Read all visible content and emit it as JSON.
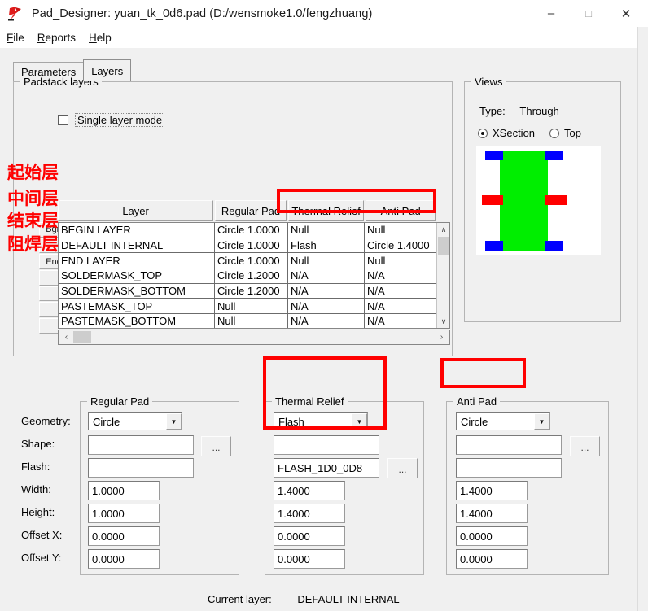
{
  "window": {
    "title": "Pad_Designer: yuan_tk_0d6.pad (D:/wensmoke1.0/fengzhuang)",
    "icon": "pad-designer-icon",
    "minimize": "–",
    "maximize": "□",
    "close": "✕"
  },
  "menubar": {
    "items": [
      {
        "label": "File",
        "accel": "F"
      },
      {
        "label": "Reports",
        "accel": "R"
      },
      {
        "label": "Help",
        "accel": "H"
      }
    ]
  },
  "tabs": [
    {
      "label": "Parameters",
      "active": false
    },
    {
      "label": "Layers",
      "active": true
    }
  ],
  "padstack": {
    "group_title": "Padstack layers",
    "single_layer_mode": {
      "label": "Single layer mode",
      "checked": false
    },
    "columns": [
      "Layer",
      "Regular Pad",
      "Thermal Relief",
      "Anti Pad"
    ],
    "stub_buttons": [
      "Bgn",
      "",
      "End",
      "",
      "",
      "",
      ""
    ],
    "rows": [
      {
        "layer": "BEGIN LAYER",
        "regular": "Circle 1.0000",
        "thermal": "Null",
        "anti": "Null"
      },
      {
        "layer": "DEFAULT INTERNAL",
        "regular": "Circle 1.0000",
        "thermal": "Flash",
        "anti": "Circle 1.4000"
      },
      {
        "layer": "END LAYER",
        "regular": "Circle 1.0000",
        "thermal": "Null",
        "anti": "Null"
      },
      {
        "layer": "SOLDERMASK_TOP",
        "regular": "Circle 1.2000",
        "thermal": "N/A",
        "anti": "N/A"
      },
      {
        "layer": "SOLDERMASK_BOTTOM",
        "regular": "Circle 1.2000",
        "thermal": "N/A",
        "anti": "N/A"
      },
      {
        "layer": "PASTEMASK_TOP",
        "regular": "Null",
        "thermal": "N/A",
        "anti": "N/A"
      },
      {
        "layer": "PASTEMASK_BOTTOM",
        "regular": "Null",
        "thermal": "N/A",
        "anti": "N/A"
      }
    ],
    "scroll": {
      "up_arrow": "∧",
      "down_arrow": "∨",
      "left_arrow": "‹",
      "right_arrow": "›"
    }
  },
  "views": {
    "group_title": "Views",
    "type_label": "Type:",
    "type_value": "Through",
    "radios": [
      {
        "label": "XSection",
        "selected": true
      },
      {
        "label": "Top",
        "selected": false
      }
    ],
    "colors": {
      "pad": "#00ee00",
      "regular": "#0000ff",
      "thermal": "#ff0000",
      "background": "#ffffff"
    }
  },
  "fields": {
    "labels": [
      "Geometry:",
      "Shape:",
      "Flash:",
      "Width:",
      "Height:",
      "Offset X:",
      "Offset Y:"
    ],
    "ellipsis": "..."
  },
  "panels": {
    "regular_pad": {
      "title": "Regular Pad",
      "geometry": "Circle",
      "shape": "",
      "flash": "",
      "width": "1.0000",
      "height": "1.0000",
      "offset_x": "0.0000",
      "offset_y": "0.0000"
    },
    "thermal_relief": {
      "title": "Thermal Relief",
      "geometry": "Flash",
      "shape": "",
      "flash": "FLASH_1D0_0D8",
      "width": "1.4000",
      "height": "1.4000",
      "offset_x": "0.0000",
      "offset_y": "0.0000"
    },
    "anti_pad": {
      "title": "Anti Pad",
      "geometry": "Circle",
      "shape": "",
      "flash": "",
      "width": "1.4000",
      "height": "1.4000",
      "offset_x": "0.0000",
      "offset_y": "0.0000"
    }
  },
  "status": {
    "label": "Current layer:",
    "value": "DEFAULT INTERNAL"
  },
  "annotations": {
    "color": "#ff0000",
    "notes": [
      {
        "text": "起始层"
      },
      {
        "text": "中间层"
      },
      {
        "text": "结束层"
      },
      {
        "text": "阻焊层"
      }
    ]
  }
}
